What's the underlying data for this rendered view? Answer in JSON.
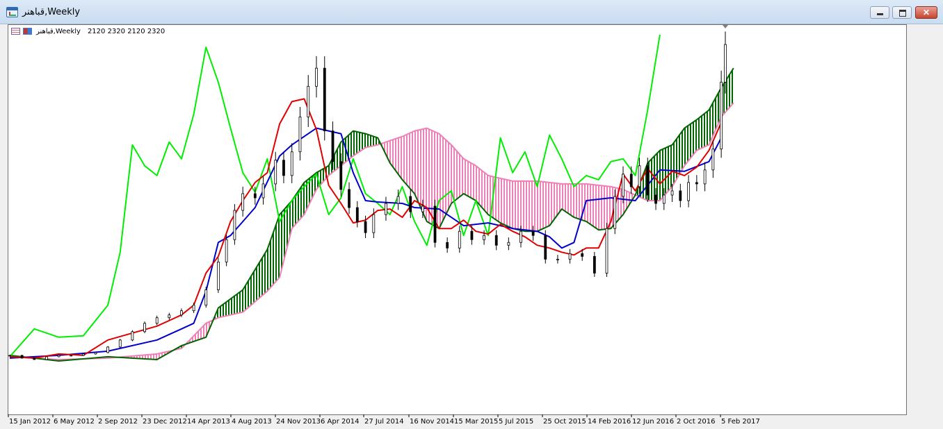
{
  "window": {
    "title": "قباهنر,Weekly",
    "buttons": {
      "minimize": "minimize",
      "maximize": "maximize",
      "close": "close"
    }
  },
  "chart_header": {
    "symbol_period": "قباهنر,Weekly",
    "ohlc": "2120 2320 2120 2320"
  },
  "colors": {
    "background": "#ffffff",
    "candle": "#000000",
    "tenkan": "#e00000",
    "kijun": "#0000cc",
    "chikou": "#00ee00",
    "senkou_a": "#006400",
    "senkou_b": "#ee7fb7",
    "cloud_bull": "#006400",
    "cloud_bear": "#ee7fb7"
  },
  "chart_data": {
    "type": "line",
    "title": "",
    "x_tick_labels": [
      "15 Jan 2012",
      "6 May 2012",
      "2 Sep 2012",
      "23 Dec 2012",
      "14 Apr 2013",
      "4 Aug 2013",
      "24 Nov 2013",
      "6 Apr 2014",
      "27 Jul 2014",
      "16 Nov 2014",
      "15 Mar 2015",
      "5 Jul 2015",
      "25 Oct 2015",
      "14 Feb 2016",
      "12 Jun 2016",
      "2 Oct 2016",
      "5 Feb 2017"
    ],
    "ylim": [
      0,
      2400
    ],
    "grid": false,
    "series": [
      {
        "key": "price",
        "type": "candlestick",
        "values": [
          [
            0,
            90
          ],
          [
            3,
            70
          ],
          [
            6,
            60
          ],
          [
            9,
            80
          ],
          [
            12,
            90
          ],
          [
            15,
            90
          ],
          [
            18,
            100
          ],
          [
            21,
            110
          ],
          [
            24,
            150
          ],
          [
            27,
            200
          ],
          [
            30,
            260
          ],
          [
            33,
            320
          ],
          [
            36,
            360
          ],
          [
            39,
            380
          ],
          [
            42,
            410
          ],
          [
            45,
            450
          ],
          [
            48,
            560
          ],
          [
            51,
            760
          ],
          [
            53,
            920
          ],
          [
            55,
            1130
          ],
          [
            57,
            1250
          ],
          [
            60,
            1220
          ],
          [
            62,
            1320
          ],
          [
            65,
            1490
          ],
          [
            67,
            1380
          ],
          [
            69,
            1550
          ],
          [
            71,
            1800
          ],
          [
            73,
            2020
          ],
          [
            75,
            2150
          ],
          [
            77,
            1700
          ],
          [
            79,
            1480
          ],
          [
            81,
            1280
          ],
          [
            83,
            1150
          ],
          [
            85,
            1050
          ],
          [
            87,
            970
          ],
          [
            89,
            1100
          ],
          [
            92,
            1180
          ],
          [
            95,
            1230
          ],
          [
            98,
            1120
          ],
          [
            101,
            1160
          ],
          [
            104,
            900
          ],
          [
            107,
            860
          ],
          [
            110,
            980
          ],
          [
            113,
            920
          ],
          [
            116,
            950
          ],
          [
            119,
            880
          ],
          [
            122,
            900
          ],
          [
            125,
            980
          ],
          [
            128,
            950
          ],
          [
            131,
            780
          ],
          [
            134,
            780
          ],
          [
            137,
            820
          ],
          [
            140,
            800
          ],
          [
            143,
            680
          ],
          [
            146,
            1000
          ],
          [
            148,
            1230
          ],
          [
            150,
            1390
          ],
          [
            152,
            1300
          ],
          [
            154,
            1450
          ],
          [
            156,
            1240
          ],
          [
            158,
            1180
          ],
          [
            160,
            1240
          ],
          [
            162,
            1270
          ],
          [
            164,
            1200
          ],
          [
            166,
            1330
          ],
          [
            168,
            1320
          ],
          [
            170,
            1420
          ],
          [
            172,
            1570
          ],
          [
            174,
            2050
          ],
          [
            175,
            2320
          ]
        ]
      },
      {
        "key": "tenkan",
        "type": "line",
        "values": [
          [
            0,
            80
          ],
          [
            6,
            70
          ],
          [
            12,
            100
          ],
          [
            18,
            90
          ],
          [
            24,
            200
          ],
          [
            30,
            250
          ],
          [
            36,
            300
          ],
          [
            42,
            380
          ],
          [
            45,
            450
          ],
          [
            48,
            680
          ],
          [
            51,
            800
          ],
          [
            54,
            1050
          ],
          [
            57,
            1200
          ],
          [
            60,
            1330
          ],
          [
            63,
            1400
          ],
          [
            66,
            1750
          ],
          [
            69,
            1910
          ],
          [
            72,
            1930
          ],
          [
            75,
            1710
          ],
          [
            78,
            1310
          ],
          [
            81,
            1180
          ],
          [
            84,
            1040
          ],
          [
            87,
            1060
          ],
          [
            90,
            1130
          ],
          [
            93,
            1140
          ],
          [
            96,
            1080
          ],
          [
            99,
            1200
          ],
          [
            102,
            1150
          ],
          [
            105,
            1000
          ],
          [
            108,
            1000
          ],
          [
            111,
            1060
          ],
          [
            114,
            980
          ],
          [
            117,
            960
          ],
          [
            120,
            1030
          ],
          [
            123,
            980
          ],
          [
            126,
            940
          ],
          [
            129,
            880
          ],
          [
            132,
            860
          ],
          [
            135,
            830
          ],
          [
            138,
            810
          ],
          [
            141,
            860
          ],
          [
            144,
            860
          ],
          [
            147,
            1050
          ],
          [
            150,
            1390
          ],
          [
            153,
            1270
          ],
          [
            156,
            1430
          ],
          [
            159,
            1320
          ],
          [
            162,
            1410
          ],
          [
            165,
            1380
          ],
          [
            168,
            1440
          ],
          [
            171,
            1560
          ],
          [
            174,
            1760
          ]
        ]
      },
      {
        "key": "kijun",
        "type": "line",
        "values": [
          [
            0,
            70
          ],
          [
            12,
            90
          ],
          [
            24,
            120
          ],
          [
            36,
            200
          ],
          [
            42,
            280
          ],
          [
            45,
            320
          ],
          [
            48,
            550
          ],
          [
            51,
            900
          ],
          [
            54,
            950
          ],
          [
            57,
            1050
          ],
          [
            60,
            1150
          ],
          [
            66,
            1520
          ],
          [
            69,
            1600
          ],
          [
            75,
            1720
          ],
          [
            81,
            1680
          ],
          [
            84,
            1400
          ],
          [
            87,
            1200
          ],
          [
            90,
            1190
          ],
          [
            96,
            1180
          ],
          [
            99,
            1150
          ],
          [
            105,
            1140
          ],
          [
            111,
            1020
          ],
          [
            117,
            1040
          ],
          [
            123,
            1000
          ],
          [
            129,
            980
          ],
          [
            132,
            940
          ],
          [
            135,
            860
          ],
          [
            138,
            900
          ],
          [
            141,
            1200
          ],
          [
            147,
            1220
          ],
          [
            153,
            1200
          ],
          [
            159,
            1420
          ],
          [
            165,
            1410
          ],
          [
            171,
            1480
          ],
          [
            174,
            1650
          ]
        ]
      },
      {
        "key": "chikou",
        "type": "line",
        "values": [
          [
            0,
            80
          ],
          [
            6,
            280
          ],
          [
            12,
            220
          ],
          [
            18,
            230
          ],
          [
            24,
            450
          ],
          [
            27,
            830
          ],
          [
            30,
            1600
          ],
          [
            33,
            1450
          ],
          [
            36,
            1380
          ],
          [
            39,
            1620
          ],
          [
            42,
            1500
          ],
          [
            45,
            1820
          ],
          [
            48,
            2300
          ],
          [
            51,
            2050
          ],
          [
            54,
            1720
          ],
          [
            57,
            1400
          ],
          [
            60,
            1260
          ],
          [
            63,
            1500
          ],
          [
            66,
            1050
          ],
          [
            69,
            1200
          ],
          [
            72,
            1300
          ],
          [
            75,
            1390
          ],
          [
            78,
            1100
          ],
          [
            81,
            1220
          ],
          [
            84,
            1500
          ],
          [
            87,
            1250
          ],
          [
            90,
            1180
          ],
          [
            93,
            1100
          ],
          [
            96,
            1300
          ],
          [
            99,
            1050
          ],
          [
            102,
            880
          ],
          [
            105,
            1200
          ],
          [
            108,
            1270
          ],
          [
            111,
            950
          ],
          [
            114,
            1200
          ],
          [
            117,
            950
          ],
          [
            120,
            1650
          ],
          [
            123,
            1400
          ],
          [
            126,
            1550
          ],
          [
            129,
            1300
          ],
          [
            132,
            1670
          ],
          [
            135,
            1500
          ],
          [
            138,
            1300
          ],
          [
            141,
            1380
          ],
          [
            144,
            1350
          ],
          [
            147,
            1480
          ],
          [
            150,
            1500
          ],
          [
            153,
            1380
          ],
          [
            156,
            1850
          ],
          [
            159,
            2390
          ]
        ]
      },
      {
        "key": "senkou_a",
        "type": "line",
        "values": [
          [
            0,
            90
          ],
          [
            12,
            50
          ],
          [
            24,
            80
          ],
          [
            36,
            60
          ],
          [
            42,
            160
          ],
          [
            48,
            220
          ],
          [
            51,
            430
          ],
          [
            57,
            560
          ],
          [
            63,
            850
          ],
          [
            66,
            1100
          ],
          [
            69,
            1200
          ],
          [
            72,
            1330
          ],
          [
            75,
            1400
          ],
          [
            78,
            1450
          ],
          [
            81,
            1620
          ],
          [
            84,
            1700
          ],
          [
            87,
            1680
          ],
          [
            90,
            1650
          ],
          [
            93,
            1470
          ],
          [
            96,
            1350
          ],
          [
            99,
            1250
          ],
          [
            102,
            1050
          ],
          [
            105,
            1000
          ],
          [
            108,
            1180
          ],
          [
            111,
            1250
          ],
          [
            114,
            1200
          ],
          [
            117,
            1100
          ],
          [
            120,
            1040
          ],
          [
            123,
            1000
          ],
          [
            126,
            980
          ],
          [
            129,
            980
          ],
          [
            132,
            1020
          ],
          [
            135,
            1140
          ],
          [
            138,
            1080
          ],
          [
            141,
            1050
          ],
          [
            144,
            990
          ],
          [
            147,
            1000
          ],
          [
            150,
            1100
          ],
          [
            153,
            1240
          ],
          [
            156,
            1470
          ],
          [
            159,
            1560
          ],
          [
            162,
            1600
          ],
          [
            165,
            1720
          ],
          [
            168,
            1780
          ],
          [
            171,
            1850
          ],
          [
            174,
            2010
          ],
          [
            177,
            2150
          ]
        ]
      },
      {
        "key": "senkou_b",
        "type": "line",
        "values": [
          [
            0,
            80
          ],
          [
            12,
            60
          ],
          [
            24,
            70
          ],
          [
            36,
            100
          ],
          [
            42,
            140
          ],
          [
            48,
            320
          ],
          [
            51,
            360
          ],
          [
            57,
            400
          ],
          [
            63,
            550
          ],
          [
            66,
            650
          ],
          [
            69,
            1000
          ],
          [
            72,
            1100
          ],
          [
            75,
            1280
          ],
          [
            78,
            1380
          ],
          [
            81,
            1450
          ],
          [
            84,
            1520
          ],
          [
            87,
            1580
          ],
          [
            90,
            1600
          ],
          [
            93,
            1630
          ],
          [
            96,
            1660
          ],
          [
            99,
            1700
          ],
          [
            102,
            1720
          ],
          [
            105,
            1680
          ],
          [
            108,
            1600
          ],
          [
            111,
            1500
          ],
          [
            114,
            1450
          ],
          [
            117,
            1380
          ],
          [
            120,
            1360
          ],
          [
            123,
            1340
          ],
          [
            126,
            1340
          ],
          [
            129,
            1340
          ],
          [
            132,
            1330
          ],
          [
            135,
            1320
          ],
          [
            138,
            1320
          ],
          [
            141,
            1320
          ],
          [
            144,
            1310
          ],
          [
            147,
            1300
          ],
          [
            150,
            1280
          ],
          [
            153,
            1240
          ],
          [
            156,
            1200
          ],
          [
            159,
            1200
          ],
          [
            162,
            1300
          ],
          [
            165,
            1450
          ],
          [
            168,
            1560
          ],
          [
            171,
            1600
          ],
          [
            174,
            1800
          ],
          [
            177,
            1900
          ]
        ]
      }
    ]
  }
}
